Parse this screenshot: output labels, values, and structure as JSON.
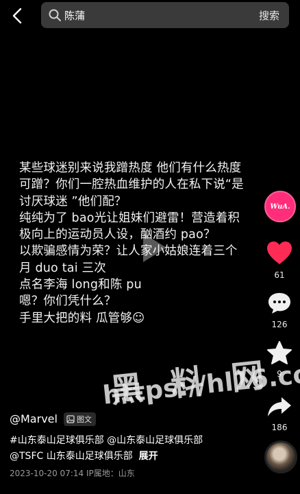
{
  "header": {
    "back_icon": "chevron-left-icon",
    "search_query": "陈蒲",
    "search_button": "搜索"
  },
  "post": {
    "lines": [
      "某些球迷别来说我蹭热度 他们有什么热度",
      "可蹭？你们一腔热血维护的人在私下说“是",
      "讨厌球迷 ”他们配？",
      "纯纯为了 bao光让姐妹们避雷！营造着积",
      "极向上的运动员人设，酗酒约 pao？",
      "以欺骗感情为荣？让人家小姑娘连着三个",
      "月 duo tai 三次",
      "点名李海 long和陈 pu",
      "嗯？你们凭什么？",
      "手里大把的料 瓜管够☺"
    ]
  },
  "rail": {
    "avatar_logo": "WuA.",
    "like_count": "61",
    "comment_count": "126",
    "favorite_count": "9",
    "share_count": "186",
    "like_color": "#fe2c55"
  },
  "watermark": {
    "line1": "黑 料 网",
    "line2": "https://hl16.co"
  },
  "author": {
    "name": "@Marvel",
    "badge_label": "图文",
    "desc_line1": "#山东泰山足球俱乐部 @山东泰山足球俱乐部",
    "desc_line2": "@TSFC 山东泰山足球俱乐部",
    "expand_label": "展开",
    "meta": "2023-10-20 07:14  IP属地：山东"
  }
}
